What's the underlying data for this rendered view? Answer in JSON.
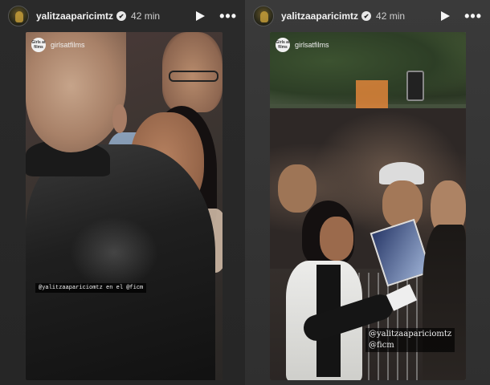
{
  "stories": [
    {
      "username": "yalitzaaparicimtz",
      "verified_glyph": "✔",
      "time": "42 min",
      "play_icon": "play-icon",
      "more_icon": "more-icon",
      "more_glyph": "•••",
      "source": {
        "name": "girlsatfilms",
        "logo_text": "Girls at films"
      },
      "caption_lines": [
        "@yalitzaapariciomtz en el @ficm"
      ]
    },
    {
      "username": "yalitzaaparicimtz",
      "verified_glyph": "✔",
      "time": "42 min",
      "play_icon": "play-icon",
      "more_icon": "more-icon",
      "more_glyph": "•••",
      "source": {
        "name": "girlsatfilms",
        "logo_text": "Girls at films"
      },
      "caption_lines": [
        "@yalitzaapariciomtz",
        "@ficm"
      ]
    }
  ]
}
